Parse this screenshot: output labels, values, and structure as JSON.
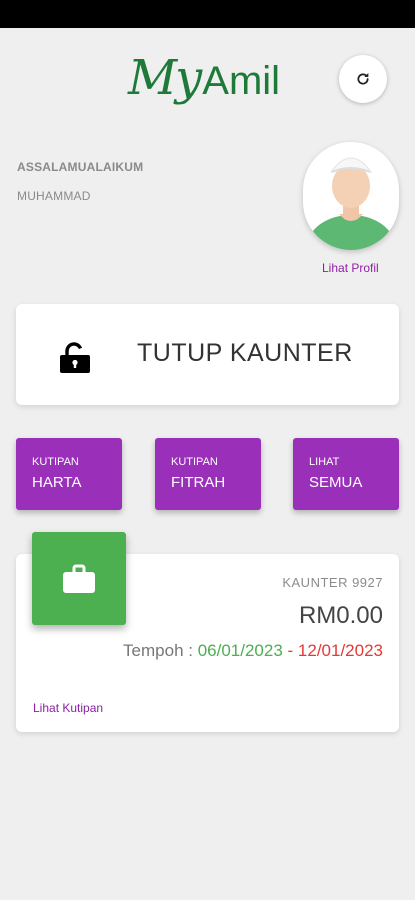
{
  "app": {
    "logo_my": "My",
    "logo_amil": "Amil"
  },
  "user": {
    "greeting": "ASSALAMUALAIKUM",
    "name": "MUHAMMAD",
    "profile_link": "Lihat Profil"
  },
  "counter_toggle": {
    "label": "TUTUP KAUNTER"
  },
  "actions": [
    {
      "small": "KUTIPAN",
      "big": "HARTA"
    },
    {
      "small": "KUTIPAN",
      "big": "FITRAH"
    },
    {
      "small": "LIHAT",
      "big": "SEMUA"
    }
  ],
  "summary": {
    "counter_id": "KAUNTER 9927",
    "amount": "RM0.00",
    "period_label": "Tempoh : ",
    "date_start": "06/01/2023",
    "date_separator": " - ",
    "date_end": "12/01/2023",
    "view_link": "Lihat Kutipan"
  },
  "colors": {
    "brand_green": "#1f7a3a",
    "action_purple": "#9a2fb9",
    "tile_green": "#4caf50",
    "end_date_red": "#e53935"
  },
  "icons": [
    "refresh-icon",
    "unlock-icon",
    "briefcase-icon"
  ]
}
